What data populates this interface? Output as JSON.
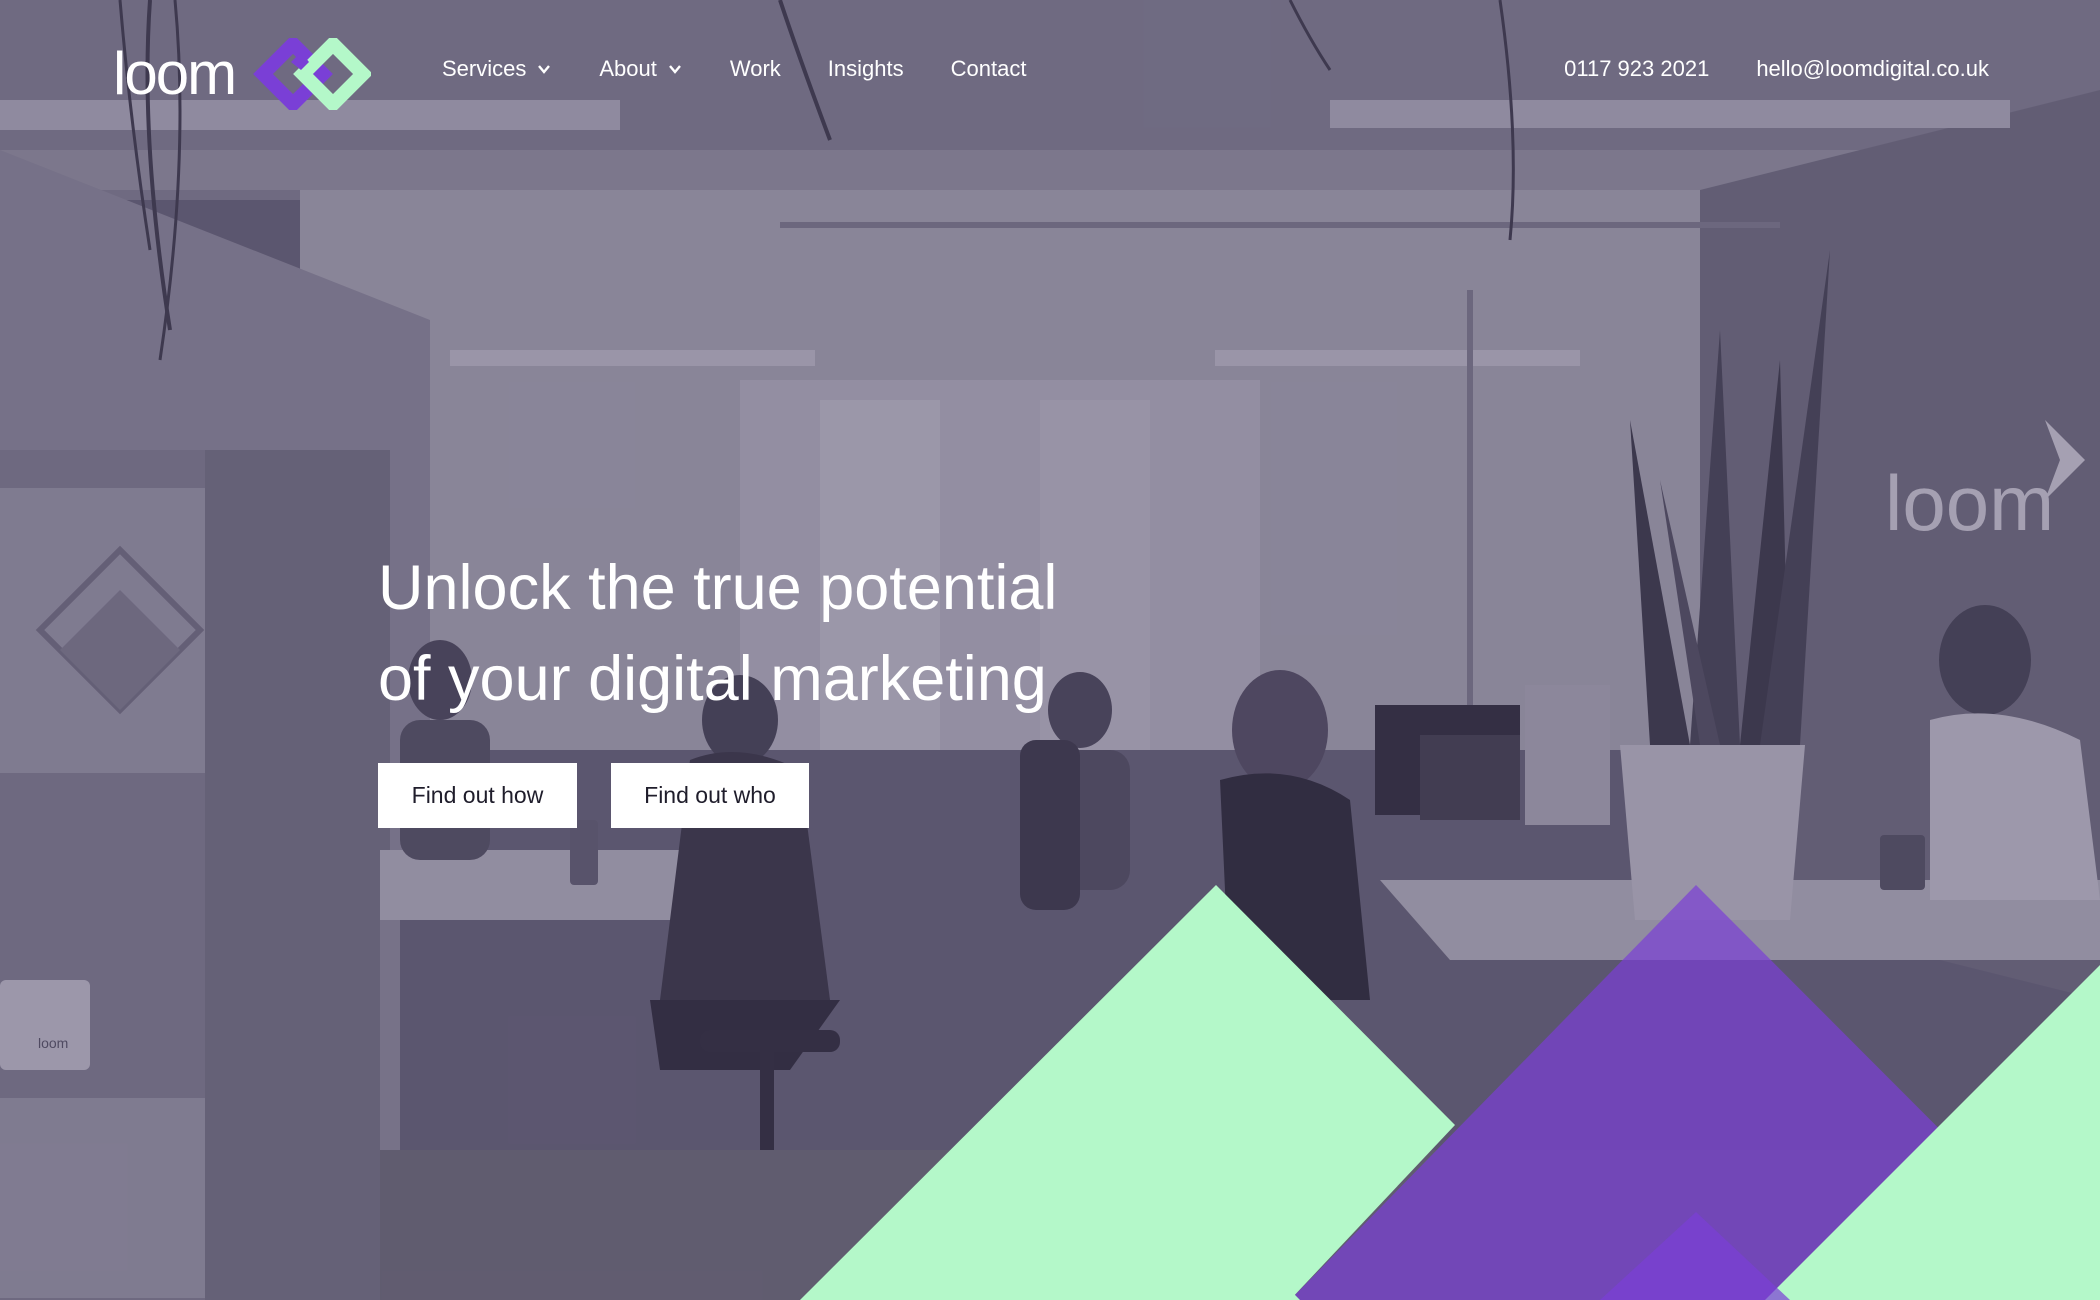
{
  "header": {
    "logo_text": "loom",
    "nav": [
      {
        "label": "Services",
        "has_dropdown": true
      },
      {
        "label": "About",
        "has_dropdown": true
      },
      {
        "label": "Work",
        "has_dropdown": false
      },
      {
        "label": "Insights",
        "has_dropdown": false
      },
      {
        "label": "Contact",
        "has_dropdown": false
      }
    ],
    "phone": "0117 923 2021",
    "email": "hello@loomdigital.co.uk"
  },
  "hero": {
    "heading_line_1": "Unlock the true potential",
    "heading_line_2": "of your digital marketing",
    "cta_primary": "Find out how",
    "cta_secondary": "Find out who",
    "wall_sign_text": "loom",
    "mug_text": "loom"
  },
  "colors": {
    "brand_purple": "#7a3fd6",
    "brand_mint": "#b4f8c9",
    "text_on_dark": "#ffffff",
    "button_bg": "#ffffff",
    "button_text": "#1f1d2b"
  },
  "icons": {
    "dropdown": "chevron-down-icon",
    "logo_mark": "interlocking-diamonds-logo"
  }
}
